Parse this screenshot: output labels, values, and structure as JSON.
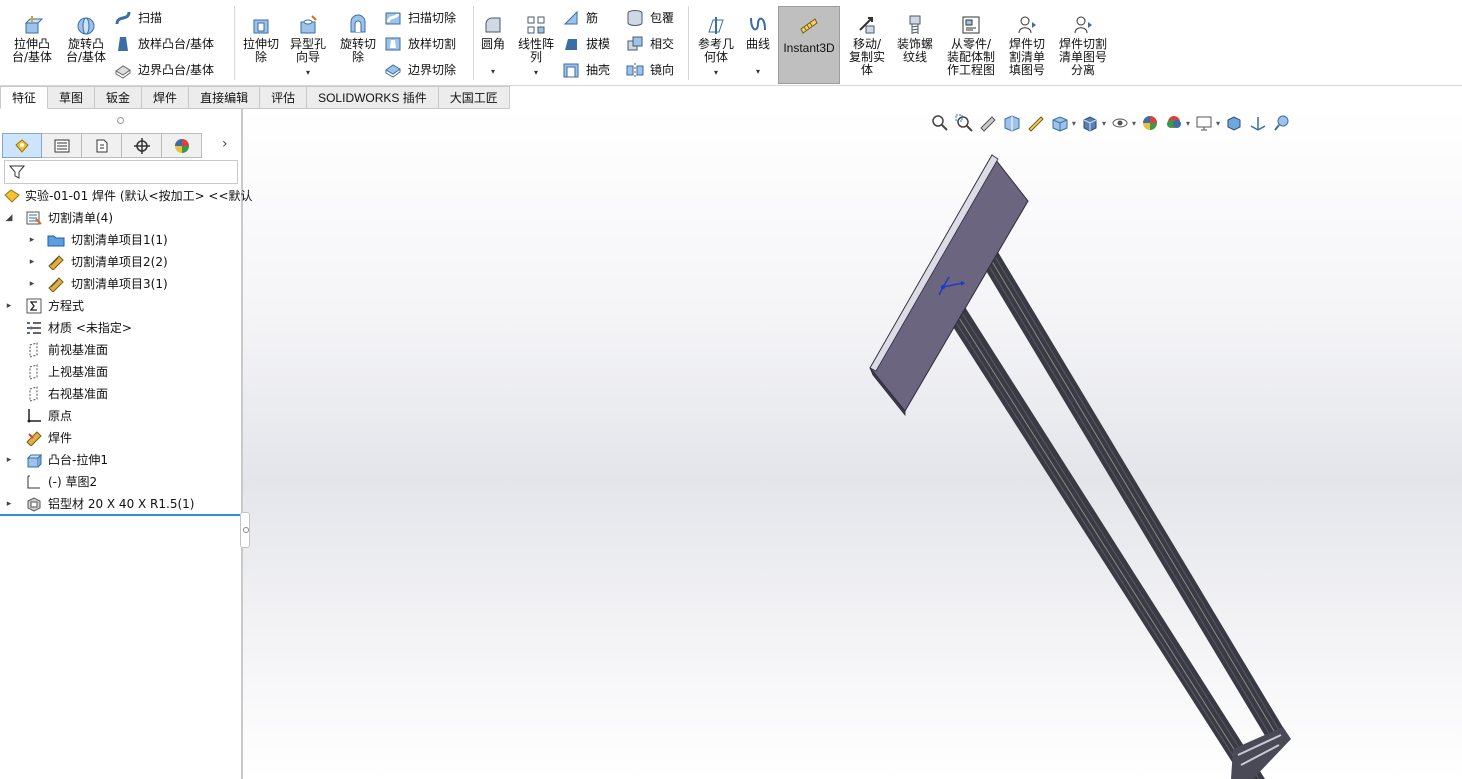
{
  "ribbon": {
    "extrude_boss": "拉伸凸\n台/基体",
    "revolve_boss": "旋转凸\n台/基体",
    "sweep": "扫描",
    "loft_boss": "放样凸台/基体",
    "boundary_boss": "边界凸台/基体",
    "extrude_cut": "拉伸切\n除",
    "hole_wizard": "异型孔\n向导",
    "revolve_cut": "旋转切\n除",
    "swept_cut": "扫描切除",
    "lofted_cut": "放样切割",
    "boundary_cut": "边界切除",
    "fillet": "圆角",
    "linear_pattern": "线性阵\n列",
    "rib": "筋",
    "draft": "拔模",
    "shell": "抽壳",
    "wrap": "包覆",
    "intersect": "相交",
    "mirror": "镜向",
    "reference_geometry": "参考几\n何体",
    "curves": "曲线",
    "instant3d": "Instant3D",
    "move_copy": "移动/\n复制实\n体",
    "cosmetic_thread": "装饰螺\n纹线",
    "make_drawing": "从零件/\n装配体制\n作工程图",
    "cutlist_balloon": "焊件切\n割清单\n填图号",
    "cutlist_separate": "焊件切割\n清单图号\n分离",
    "dropdown_glyph": "▾"
  },
  "command_tabs": [
    "特征",
    "草图",
    "钣金",
    "焊件",
    "直接编辑",
    "评估",
    "SOLIDWORKS 插件",
    "大国工匠"
  ],
  "tree": {
    "root": "实验-01-01 焊件 (默认<按加工> <<默认",
    "cutlist": "切割清单(4)",
    "cutlist_item1": "切割清单项目1(1)",
    "cutlist_item2": "切割清单项目2(2)",
    "cutlist_item3": "切割清单项目3(1)",
    "equations": "方程式",
    "material": "材质 <未指定>",
    "front_plane": "前视基准面",
    "top_plane": "上视基准面",
    "right_plane": "右视基准面",
    "origin": "原点",
    "weldment": "焊件",
    "boss_extrude": "凸台-拉伸1",
    "sketch2": "(-) 草图2",
    "profile": "铝型材 20 X 40 X R1.5(1)"
  },
  "panel": {
    "more_glyph": "›",
    "expand_glyph": "▸",
    "collapse_glyph": "◢"
  },
  "colors": {
    "plate": "#6b6580",
    "rail": "#3a3a44",
    "active_tab": "#cde4fb",
    "tree_end_line": "#2f8fd6"
  }
}
